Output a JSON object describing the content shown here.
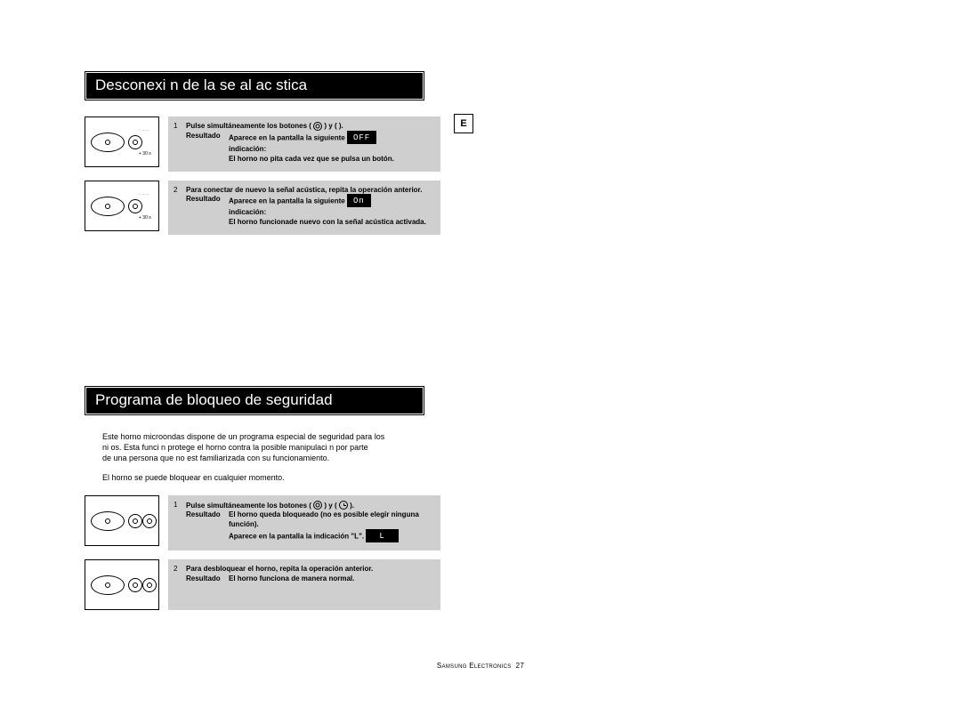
{
  "badge_e": "E",
  "sec1": {
    "title": "Desconexi  n de la se  al ac  stica",
    "step1": {
      "num": "1",
      "line1_a": "Pulse simultáneamente los botones (",
      "line1_b": ") y (",
      "line1_c": ").",
      "result_label": "Resultado",
      "result_text_a": "Aparece en la pantalla la siguiente",
      "result_text_b": "indicación:",
      "disp": "OFF",
      "tail": "El horno no pita cada vez que se pulsa un botón."
    },
    "step2": {
      "num": "2",
      "intro": "Para conectar de nuevo la señal acústica, repita la operación anterior.",
      "result_label": "Resultado",
      "result_text_a": "Aparece en la pantalla la siguiente",
      "result_text_b": "indicación:",
      "disp": "On",
      "tail": "El horno funcionade nuevo con la señal acústica activada."
    }
  },
  "sec2": {
    "title": "Programa de bloqueo de seguridad",
    "para1a": "Este horno microondas dispone de un programa especial de seguridad para los",
    "para1b": "ni os. Esta funci n protege el horno contra la posible manipulaci n por parte",
    "para1c": "de una persona que no est  familiarizada con su funcionamiento.",
    "para2": "El horno se puede bloquear en cualquier momento.",
    "step1": {
      "num": "1",
      "line1_a": "Pulse simultáneamente los botones (",
      "line1_b": ") y (",
      "line1_c": ").",
      "result_label": "Resultado",
      "result_text_a": "El horno queda bloqueado (no es posible elegir ninguna",
      "result_text_b": "función).",
      "tail_a": "Aparece en la pantalla la indicación \"L\".",
      "disp": "L"
    },
    "step2": {
      "num": "2",
      "intro": "Para desbloquear el horno, repita la operación anterior.",
      "result_label": "Resultado",
      "result_text": "El horno funciona de manera normal."
    }
  },
  "footer_brand": "Samsung Electronics",
  "footer_page": "27",
  "diagram_label": "+ 30 s"
}
